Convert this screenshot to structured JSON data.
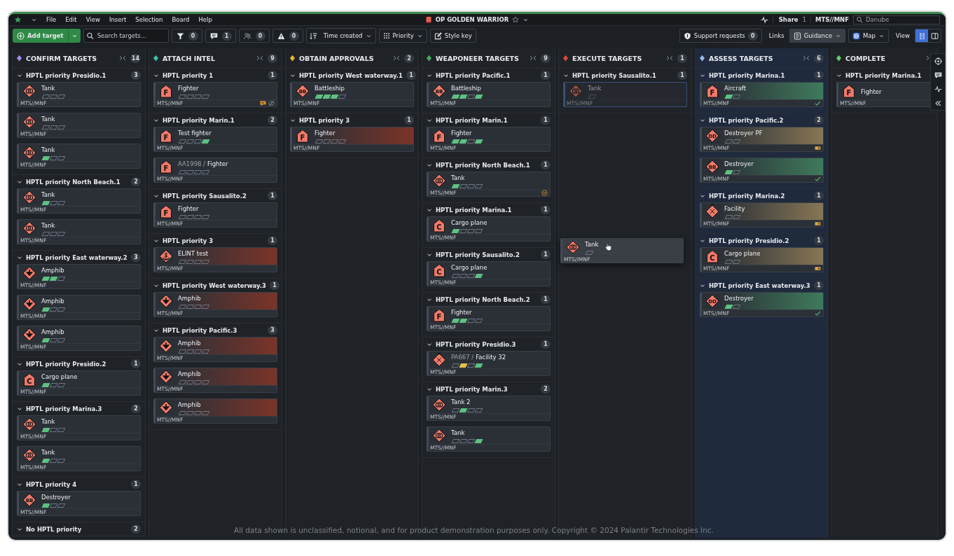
{
  "menubar": {
    "menus": [
      "File",
      "Edit",
      "View",
      "Insert",
      "Selection",
      "Board",
      "Help"
    ],
    "title": "OP GOLDEN WARRIOR",
    "share": "Share",
    "share_count": "1",
    "classification": "MTS//MNF",
    "search": {
      "placeholder": "Danube"
    }
  },
  "toolbar": {
    "add_button": "Add target",
    "search": {
      "placeholder": "Search targets..."
    },
    "filters": [
      {
        "kind": "filter",
        "count": "0"
      },
      {
        "kind": "comment",
        "count": "1"
      },
      {
        "kind": "people",
        "count": "0"
      },
      {
        "kind": "warning",
        "count": "0"
      }
    ],
    "sort": "Time created",
    "group": "Priority",
    "style_key": "Style key",
    "support": {
      "label": "Support requests",
      "count": "0"
    },
    "links_label": "Links",
    "links": [
      {
        "kind": "guidance",
        "label": "Guidance",
        "selected": true
      },
      {
        "kind": "map",
        "label": "Map",
        "selected": false
      }
    ],
    "view_label": "View",
    "views": [
      {
        "kind": "board",
        "selected": true
      },
      {
        "kind": "panel",
        "selected": false
      }
    ]
  },
  "columns": [
    {
      "title": "CONFIRM TARGETS",
      "color": "#a58bf0",
      "count": "14",
      "drop_target": false,
      "groups": [
        {
          "title": "HPTL priority Presidio.1",
          "count": "3",
          "cards": [
            {
              "icon": {
                "kind": "tank"
              },
              "title": "Tank",
              "classification": "MTS//MNF",
              "pips": [
                {
                  "filled": false
                },
                {
                  "filled": false
                },
                {
                  "filled": false
                }
              ]
            },
            {
              "icon": {
                "kind": "tank"
              },
              "title": "Tank",
              "classification": "MTS//MNF",
              "pips": [
                {
                  "filled": false
                },
                {
                  "filled": false
                },
                {
                  "filled": false
                }
              ]
            },
            {
              "icon": {
                "kind": "tank"
              },
              "title": "Tank",
              "classification": "MTS//MNF",
              "pips": [
                {
                  "filled": true
                },
                {
                  "filled": false
                },
                {
                  "filled": false
                }
              ]
            }
          ]
        },
        {
          "title": "HPTL priority North Beach.1",
          "count": "2",
          "cards": [
            {
              "icon": {
                "kind": "tank"
              },
              "title": "Tank",
              "classification": "MTS//MNF",
              "pips": [
                {
                  "filled": true
                },
                {
                  "filled": false
                },
                {
                  "filled": false
                }
              ]
            },
            {
              "icon": {
                "kind": "tank"
              },
              "title": "Tank",
              "classification": "MTS//MNF",
              "pips": [
                {
                  "filled": false
                },
                {
                  "filled": false
                },
                {
                  "filled": false
                }
              ]
            }
          ]
        },
        {
          "title": "HPTL priority East waterway.2",
          "count": "3",
          "cards": [
            {
              "icon": {
                "kind": "amphib"
              },
              "title": "Amphib",
              "classification": "MTS//MNF",
              "pips": [
                {
                  "filled": true
                },
                {
                  "filled": true
                },
                {
                  "filled": false
                }
              ]
            },
            {
              "icon": {
                "kind": "amphib"
              },
              "title": "Amphib",
              "classification": "MTS//MNF",
              "pips": [
                {
                  "filled": true
                },
                {
                  "filled": false
                },
                {
                  "filled": false
                }
              ]
            },
            {
              "icon": {
                "kind": "amphib"
              },
              "title": "Amphib",
              "classification": "MTS//MNF",
              "pips": [
                {
                  "filled": true
                },
                {
                  "filled": false
                },
                {
                  "filled": false
                }
              ]
            }
          ]
        },
        {
          "title": "HPTL priority Presidio.2",
          "count": "1",
          "cards": [
            {
              "icon": {
                "kind": "house",
                "letter": "C"
              },
              "title": "Cargo plane",
              "classification": "MTS//MNF",
              "pips": [
                {
                  "filled": true
                },
                {
                  "filled": false
                },
                {
                  "filled": false
                }
              ]
            }
          ]
        },
        {
          "title": "HPTL priority Marina.3",
          "count": "2",
          "cards": [
            {
              "icon": {
                "kind": "tank"
              },
              "title": "Tank",
              "classification": "MTS//MNF",
              "pips": [
                {
                  "filled": true
                },
                {
                  "filled": false
                },
                {
                  "filled": false
                }
              ]
            },
            {
              "icon": {
                "kind": "tank"
              },
              "title": "Tank",
              "classification": "MTS//MNF",
              "pips": [
                {
                  "filled": true
                },
                {
                  "filled": false
                },
                {
                  "filled": false
                }
              ]
            }
          ]
        },
        {
          "title": "HPTL priority 4",
          "count": "1",
          "cards": [
            {
              "icon": {
                "kind": "diamond",
                "letter": "BB"
              },
              "title": "Destroyer",
              "classification": "MTS//MNF",
              "pips": [
                {
                  "filled": true
                },
                {
                  "filled": false
                },
                {
                  "filled": false
                }
              ]
            }
          ]
        },
        {
          "title": "No HPTL priority",
          "count": "2"
        }
      ]
    },
    {
      "title": "ATTACH INTEL",
      "color": "#3dbfa8",
      "count": "9",
      "drop_target": false,
      "groups": [
        {
          "title": "HPTL priority 1",
          "count": "1",
          "cards": [
            {
              "icon": {
                "kind": "house",
                "letter": "F"
              },
              "title": "Fighter",
              "classification": "MTS//MNF",
              "pips": [
                {
                  "filled": false
                },
                {
                  "filled": false
                },
                {
                  "filled": false
                },
                {
                  "filled": false
                }
              ],
              "indicators": [
                {
                  "kind": "comment"
                },
                {
                  "kind": "hidden"
                }
              ]
            }
          ]
        },
        {
          "title": "HPTL priority Marin.1",
          "count": "2",
          "cards": [
            {
              "icon": {
                "kind": "house",
                "letter": "F"
              },
              "title": "Test fighter",
              "classification": "MTS//MNF",
              "pips": [
                {
                  "filled": false
                },
                {
                  "filled": false
                },
                {
                  "filled": false
                },
                {
                  "filled": true
                }
              ]
            },
            {
              "icon": {
                "kind": "house",
                "letter": "F"
              },
              "prefix": "AA1998 /",
              "title": "Fighter",
              "classification": "MTS//MNF",
              "pips": [
                {
                  "filled": false
                },
                {
                  "filled": false
                },
                {
                  "filled": false
                },
                {
                  "filled": false
                }
              ]
            }
          ]
        },
        {
          "title": "HPTL priority Sausalito.2",
          "count": "1",
          "cards": [
            {
              "icon": {
                "kind": "house",
                "letter": "F"
              },
              "title": "Fighter",
              "classification": "MTS//MNF",
              "pips": [
                {
                  "filled": false
                },
                {
                  "filled": false
                },
                {
                  "filled": false
                },
                {
                  "filled": false
                }
              ]
            }
          ]
        },
        {
          "title": "HPTL priority 3",
          "count": "1",
          "cards": [
            {
              "icon": {
                "kind": "elint"
              },
              "title": "ELINT test",
              "color": "#7b3428",
              "classification": "MTS//MNF",
              "pips": [
                {
                  "filled": false
                },
                {
                  "filled": false
                },
                {
                  "filled": false
                },
                {
                  "filled": false
                }
              ]
            }
          ]
        },
        {
          "title": "HPTL priority West waterway.3",
          "count": "1",
          "cards": [
            {
              "icon": {
                "kind": "amphib"
              },
              "title": "Amphib",
              "color": "#7b3428",
              "classification": "MTS//MNF",
              "pips": [
                {
                  "filled": false
                },
                {
                  "filled": false
                },
                {
                  "filled": false
                },
                {
                  "filled": false
                }
              ]
            }
          ]
        },
        {
          "title": "HPTL priority Pacific.3",
          "count": "3",
          "cards": [
            {
              "icon": {
                "kind": "amphib"
              },
              "title": "Amphib",
              "color": "#7b3428",
              "classification": "MTS//MNF",
              "pips": [
                {
                  "filled": false
                },
                {
                  "filled": false
                },
                {
                  "filled": false
                },
                {
                  "filled": false
                }
              ]
            },
            {
              "icon": {
                "kind": "amphib"
              },
              "title": "Amphib",
              "color": "#7b3428",
              "classification": "MTS//MNF",
              "pips": [
                {
                  "filled": false
                },
                {
                  "filled": false
                },
                {
                  "filled": false
                },
                {
                  "filled": false
                }
              ]
            },
            {
              "icon": {
                "kind": "amphib"
              },
              "title": "Amphib",
              "color": "#7b3428",
              "classification": "MTS//MNF",
              "pips": [
                {
                  "filled": false
                },
                {
                  "filled": false
                },
                {
                  "filled": false
                },
                {
                  "filled": false
                }
              ]
            }
          ]
        }
      ]
    },
    {
      "title": "OBTAIN APPROVALS",
      "color": "#e8b830",
      "count": "2",
      "drop_target": false,
      "groups": [
        {
          "title": "HPTL priority West waterway.1",
          "count": "1",
          "cards": [
            {
              "icon": {
                "kind": "diamond",
                "letter": "BB"
              },
              "title": "Battleship",
              "classification": "MTS//MNF",
              "pips": [
                {
                  "filled": true
                },
                {
                  "filled": true
                },
                {
                  "filled": true
                },
                {
                  "filled": false
                }
              ]
            }
          ]
        },
        {
          "title": "HPTL priority 3",
          "count": "1",
          "cards": [
            {
              "icon": {
                "kind": "house",
                "letter": "F"
              },
              "title": "Fighter",
              "color": "#7b3428",
              "classification": "MTS//MNF",
              "pips": [
                {
                  "filled": false
                },
                {
                  "filled": false
                },
                {
                  "filled": false
                },
                {
                  "filled": false
                }
              ]
            }
          ]
        }
      ]
    },
    {
      "title": "WEAPONEER TARGETS",
      "color": "#3fae5a",
      "count": "9",
      "drop_target": false,
      "groups": [
        {
          "title": "HPTL priority Pacific.1",
          "count": "1",
          "cards": [
            {
              "icon": {
                "kind": "diamond",
                "letter": "BB"
              },
              "title": "Battleship",
              "classification": "MTS//MNF",
              "pips": [
                {
                  "filled": true
                },
                {
                  "filled": true
                },
                {
                  "filled": false
                },
                {
                  "filled": true
                }
              ]
            }
          ]
        },
        {
          "title": "HPTL priority Marin.1",
          "count": "1",
          "cards": [
            {
              "icon": {
                "kind": "house",
                "letter": "F"
              },
              "title": "Fighter",
              "classification": "MTS//MNF",
              "pips": [
                {
                  "filled": true
                },
                {
                  "filled": true
                },
                {
                  "filled": false
                },
                {
                  "filled": true
                }
              ]
            }
          ]
        },
        {
          "title": "HPTL priority North Beach.1",
          "count": "1",
          "cards": [
            {
              "icon": {
                "kind": "tank"
              },
              "title": "Tank",
              "classification": "MTS//MNF",
              "pips": [
                {
                  "filled": true
                },
                {
                  "filled": false
                },
                {
                  "filled": false
                },
                {
                  "filled": false
                }
              ],
              "indicators": [
                {
                  "kind": "blocked"
                }
              ]
            }
          ]
        },
        {
          "title": "HPTL priority Marina.1",
          "count": "1",
          "cards": [
            {
              "icon": {
                "kind": "house",
                "letter": "C"
              },
              "title": "Cargo plane",
              "classification": "MTS//MNF",
              "pips": [
                {
                  "filled": true
                },
                {
                  "filled": false
                },
                {
                  "filled": false
                },
                {
                  "filled": false
                }
              ]
            }
          ]
        },
        {
          "title": "HPTL priority Sausalito.2",
          "count": "1",
          "cards": [
            {
              "icon": {
                "kind": "house",
                "letter": "C"
              },
              "title": "Cargo plane",
              "classification": "MTS//MNF",
              "pips": [
                {
                  "filled": false
                },
                {
                  "filled": false
                },
                {
                  "filled": false
                },
                {
                  "filled": true
                }
              ]
            }
          ]
        },
        {
          "title": "HPTL priority North Beach.2",
          "count": "1",
          "cards": [
            {
              "icon": {
                "kind": "house",
                "letter": "F"
              },
              "title": "Fighter",
              "classification": "MTS//MNF",
              "pips": [
                {
                  "filled": true
                },
                {
                  "filled": true
                },
                {
                  "filled": false
                },
                {
                  "filled": false
                }
              ]
            }
          ]
        },
        {
          "title": "HPTL priority Presidio.3",
          "count": "1",
          "cards": [
            {
              "icon": {
                "kind": "facility"
              },
              "prefix": "PA667 /",
              "title": "Facility 32",
              "classification": "MTS//MNF",
              "pips": [
                {
                  "filled": false
                },
                {
                  "filled": true,
                  "warning": true
                },
                {
                  "filled": false
                },
                {
                  "filled": true
                }
              ]
            }
          ]
        },
        {
          "title": "HPTL priority Marin.3",
          "count": "2",
          "cards": [
            {
              "icon": {
                "kind": "tank"
              },
              "title": "Tank 2",
              "classification": "MTS//MNF",
              "pips": [
                {
                  "filled": false
                },
                {
                  "filled": true
                },
                {
                  "filled": false
                },
                {
                  "filled": false
                }
              ]
            },
            {
              "icon": {
                "kind": "tank"
              },
              "title": "Tank",
              "classification": "MTS//MNF",
              "pips": [
                {
                  "filled": false
                },
                {
                  "filled": false
                },
                {
                  "filled": false
                },
                {
                  "filled": true
                }
              ]
            }
          ]
        }
      ]
    },
    {
      "title": "EXECUTE TARGETS",
      "color": "#e0453a",
      "count": "1",
      "drop_target": false,
      "groups": [
        {
          "title": "HPTL priority Sausalito.1",
          "count": "1",
          "cards": [
            {
              "icon": {
                "kind": "tank"
              },
              "title": "Tank",
              "dimmed": true,
              "classification": "MTS//MNF",
              "pips": [
                {
                  "filled": false
                }
              ]
            }
          ]
        }
      ]
    },
    {
      "title": "ASSESS TARGETS",
      "color": "#9ab8e8",
      "count": "6",
      "drop_target": true,
      "groups": [
        {
          "title": "HPTL priority Marina.1",
          "count": "1",
          "cards": [
            {
              "icon": {
                "kind": "house",
                "letter": "F"
              },
              "title": "Aircraft",
              "color": "#3f7a5c",
              "classification": "MTS//MNF",
              "pips": [
                {
                  "filled": true
                },
                {
                  "filled": false
                }
              ],
              "indicators": [
                {
                  "kind": "check"
                }
              ]
            }
          ]
        },
        {
          "title": "HPTL priority Pacific.2",
          "count": "2",
          "cards": [
            {
              "icon": {
                "kind": "diamond",
                "letter": "DD"
              },
              "title": "Destroyer PF",
              "color": "#877654",
              "classification": "MTS//MNF",
              "pips": [
                {
                  "filled": false
                },
                {
                  "filled": false
                }
              ],
              "indicators": [
                {
                  "kind": "tag"
                }
              ]
            },
            {
              "icon": {
                "kind": "diamond",
                "letter": "BB"
              },
              "title": "Destroyer",
              "color": "#3f7a5c",
              "classification": "MTS//MNF",
              "pips": [
                {
                  "filled": true
                },
                {
                  "filled": false
                }
              ],
              "indicators": [
                {
                  "kind": "check"
                }
              ]
            }
          ]
        },
        {
          "title": "HPTL priority Marina.2",
          "count": "1",
          "cards": [
            {
              "icon": {
                "kind": "facility"
              },
              "title": "Facility",
              "color": "#877654",
              "classification": "MTS//MNF",
              "pips": [
                {
                  "filled": false
                },
                {
                  "filled": false
                }
              ],
              "indicators": [
                {
                  "kind": "tag"
                }
              ]
            }
          ]
        },
        {
          "title": "HPTL priority Presidio.2",
          "count": "1",
          "cards": [
            {
              "icon": {
                "kind": "house",
                "letter": "C"
              },
              "title": "Cargo plane",
              "color": "#877654",
              "classification": "MTS//MNF",
              "pips": [
                {
                  "filled": false
                },
                {
                  "filled": false
                }
              ],
              "indicators": [
                {
                  "kind": "tag"
                }
              ]
            }
          ]
        },
        {
          "title": "HPTL priority East waterway.3",
          "count": "1",
          "cards": [
            {
              "icon": {
                "kind": "diamond",
                "letter": "DD"
              },
              "title": "Destroyer",
              "color": "#3f7a5c",
              "classification": "MTS//MNF",
              "pips": [
                {
                  "filled": true
                },
                {
                  "filled": false
                }
              ],
              "indicators": [
                {
                  "kind": "check"
                }
              ]
            }
          ]
        }
      ]
    },
    {
      "title": "COMPLETE",
      "color": "#5fcf6a",
      "drop_target": false,
      "groups": [
        {
          "title": "HPTL priority Marina.1",
          "cards": [
            {
              "icon": {
                "kind": "house",
                "letter": "F"
              },
              "title": "Fighter",
              "classification": "MTS//MNF"
            }
          ]
        }
      ]
    }
  ],
  "drag_preview": {
    "icon": {
      "kind": "tank"
    },
    "title": "Tank",
    "classification": "MTS//MNF",
    "pips": [
      {
        "filled": false
      }
    ]
  },
  "side_tools": [
    {
      "kind": "target"
    },
    {
      "kind": "comment"
    },
    {
      "kind": "activity"
    },
    {
      "kind": "collapse"
    }
  ],
  "footer_notice": "All data shown is unclassified, notional, and for product demonstration purposes only. Copyright © 2024 Palantir Technologies Inc."
}
